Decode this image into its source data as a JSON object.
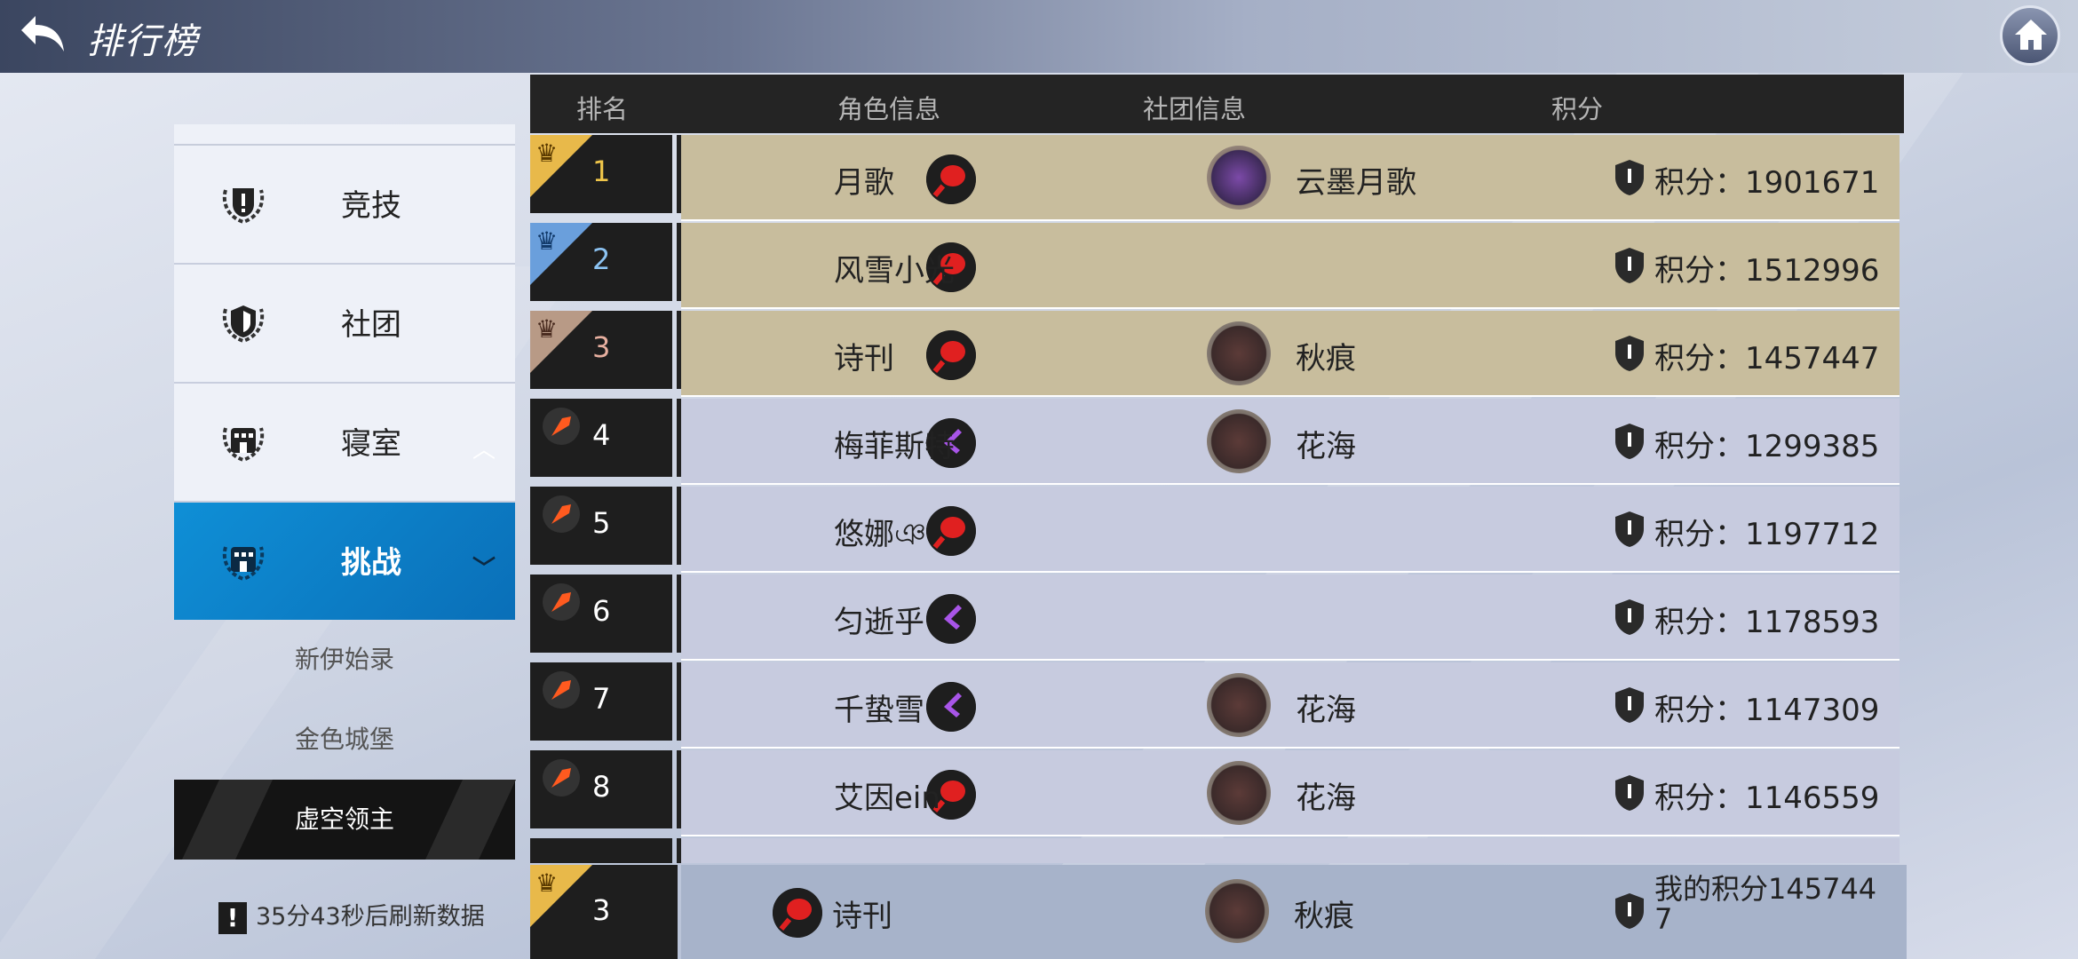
{
  "header": {
    "title": "排行榜"
  },
  "sidebar": {
    "categories": [
      {
        "label": "竞技",
        "icon": "trophy-badge-icon"
      },
      {
        "label": "社团",
        "icon": "shield-badge-icon"
      },
      {
        "label": "寝室",
        "icon": "building-badge-icon",
        "chevron": "︿"
      },
      {
        "label": "挑战",
        "icon": "building-badge-icon",
        "chevron": "﹀",
        "active": true
      }
    ],
    "subitems": [
      {
        "label": "新伊始录"
      },
      {
        "label": "金色城堡"
      },
      {
        "label": "虚空领主",
        "active": true
      }
    ],
    "refresh_icon": "!",
    "refresh_text": "35分43秒后刷新数据"
  },
  "table": {
    "headers": {
      "rank": "排名",
      "role": "角色信息",
      "club": "社团信息",
      "score": "积分"
    },
    "rows": [
      {
        "rank": "1",
        "name": "月歌",
        "club": "云墨月歌",
        "score": "积分：1901671",
        "tier": "gold",
        "avatar": "red"
      },
      {
        "rank": "2",
        "name": "风雪小光",
        "club": "",
        "score": "积分：1512996",
        "tier": "silver",
        "avatar": "red"
      },
      {
        "rank": "3",
        "name": "诗刊",
        "club": "秋痕",
        "score": "积分：1457447",
        "tier": "bronze",
        "avatar": "red"
      },
      {
        "rank": "4",
        "name": "梅菲斯特",
        "club": "花海",
        "score": "积分：1299385",
        "tier": "normal",
        "avatar": "purple"
      },
      {
        "rank": "5",
        "name": "悠娜ঞ",
        "club": "",
        "score": "积分：1197712",
        "tier": "normal",
        "avatar": "red"
      },
      {
        "rank": "6",
        "name": "匀逝乎",
        "club": "",
        "score": "积分：1178593",
        "tier": "normal",
        "avatar": "purple"
      },
      {
        "rank": "7",
        "name": "千蛰雪",
        "club": "花海",
        "score": "积分：1147309",
        "tier": "normal",
        "avatar": "purple"
      },
      {
        "rank": "8",
        "name": "艾因ein",
        "club": "花海",
        "score": "积分：1146559",
        "tier": "normal",
        "avatar": "red"
      }
    ]
  },
  "my_row": {
    "rank": "3",
    "name": "诗刊",
    "club": "秋痕",
    "score": "我的积分1457447"
  },
  "colors": {
    "accent": "#0a8fd6",
    "gold_row": "#c8bd9d",
    "blue_row": "#c7cbdf",
    "dark": "#1e1e1e"
  }
}
